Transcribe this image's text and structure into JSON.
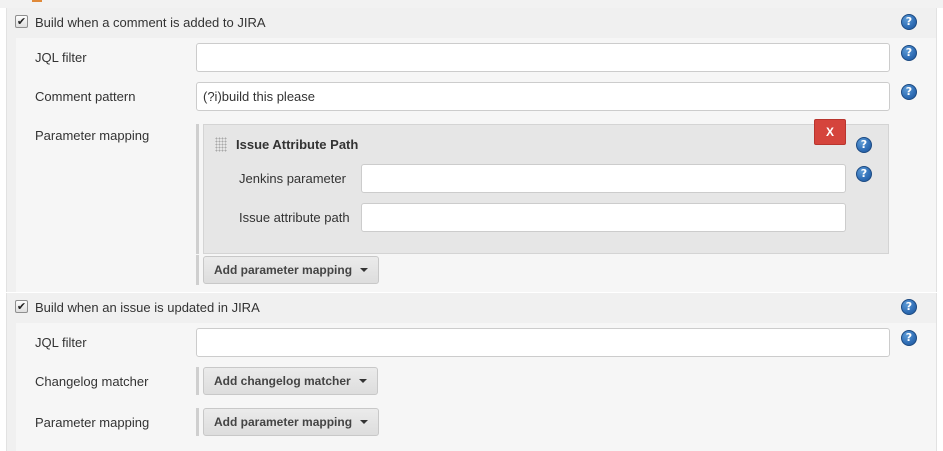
{
  "section1": {
    "checkbox_label": "Build when a comment is added to JIRA",
    "checked": true,
    "jql_filter": {
      "label": "JQL filter",
      "value": "",
      "placeholder": ""
    },
    "comment_pattern": {
      "label": "Comment pattern",
      "value": "(?i)build this please"
    },
    "parameter_mapping": {
      "label": "Parameter mapping",
      "chunk": {
        "title": "Issue Attribute Path",
        "delete_label": "X",
        "jenkins_parameter": {
          "label": "Jenkins parameter",
          "value": ""
        },
        "issue_attribute_path": {
          "label": "Issue attribute path",
          "value": ""
        }
      },
      "add_button": "Add parameter mapping"
    }
  },
  "section2": {
    "checkbox_label": "Build when an issue is updated in JIRA",
    "checked": true,
    "jql_filter": {
      "label": "JQL filter",
      "value": ""
    },
    "changelog_matcher": {
      "label": "Changelog matcher",
      "add_button": "Add changelog matcher"
    },
    "parameter_mapping": {
      "label": "Parameter mapping",
      "add_button": "Add parameter mapping"
    }
  },
  "icons": {
    "help": "?",
    "check": "✔"
  },
  "colors": {
    "help_blue": "#2f6db5",
    "delete_red": "#d5443c",
    "panel_bg": "#f0f0f0"
  }
}
